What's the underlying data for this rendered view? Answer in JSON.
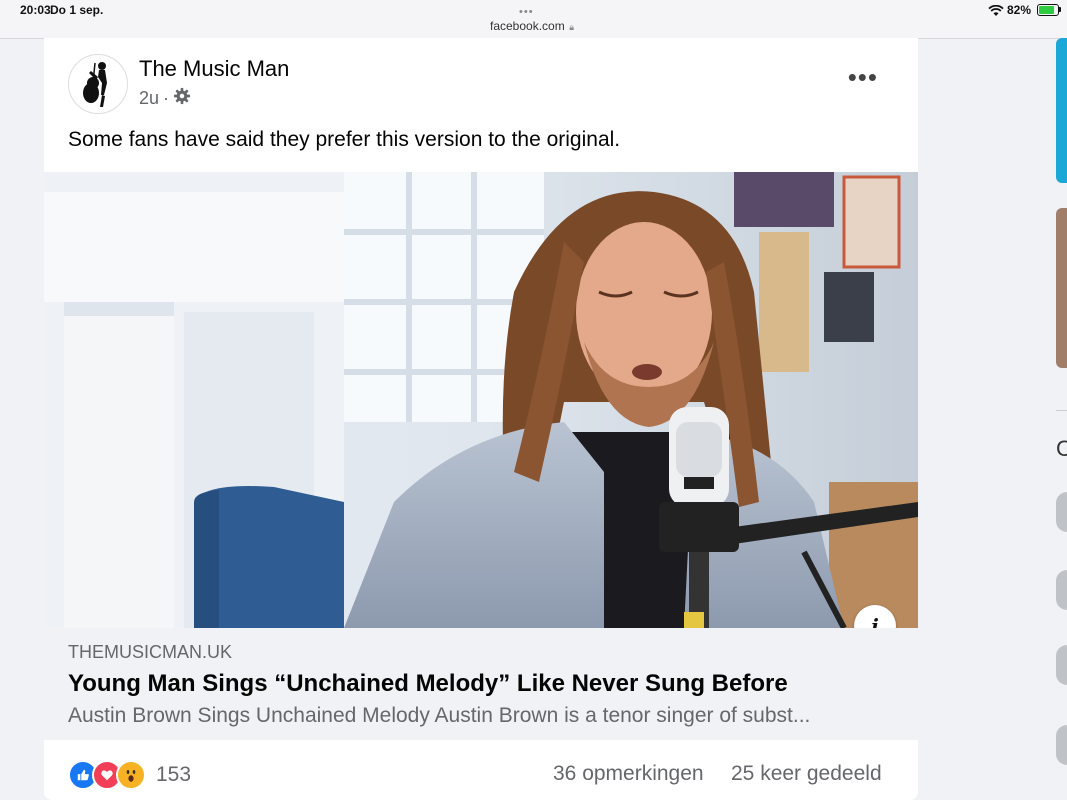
{
  "status_bar": {
    "time": "20:03",
    "date": "Do 1 sep.",
    "dots": "•••",
    "url": "facebook.com",
    "battery": "82%",
    "icons": [
      "wifi-icon",
      "lock-icon",
      "battery-charging-icon"
    ]
  },
  "post": {
    "author": "The Music Man",
    "time": "2u",
    "separator": "·",
    "more_label": "•••",
    "text": "Some fans have said they prefer this version to the original.",
    "link": {
      "domain": "THEMUSICMAN.UK",
      "title": "Young Man Sings “Unchained Melody” Like Never Sung Before",
      "description": "Austin Brown Sings Unchained Melody Austin Brown is a tenor singer of subst..."
    },
    "info_label": "i",
    "reactions": {
      "types": [
        "like",
        "love",
        "wow"
      ],
      "count": "153"
    },
    "comments": "36 opmerkingen",
    "shares": "25 keer gedeeld"
  },
  "right_column": {
    "letter": "C"
  },
  "colors": {
    "accent": "#1877f2",
    "love": "#f33e58",
    "wow": "#f7b125",
    "secondary_text": "#65676b",
    "background": "#f0f2f5"
  }
}
